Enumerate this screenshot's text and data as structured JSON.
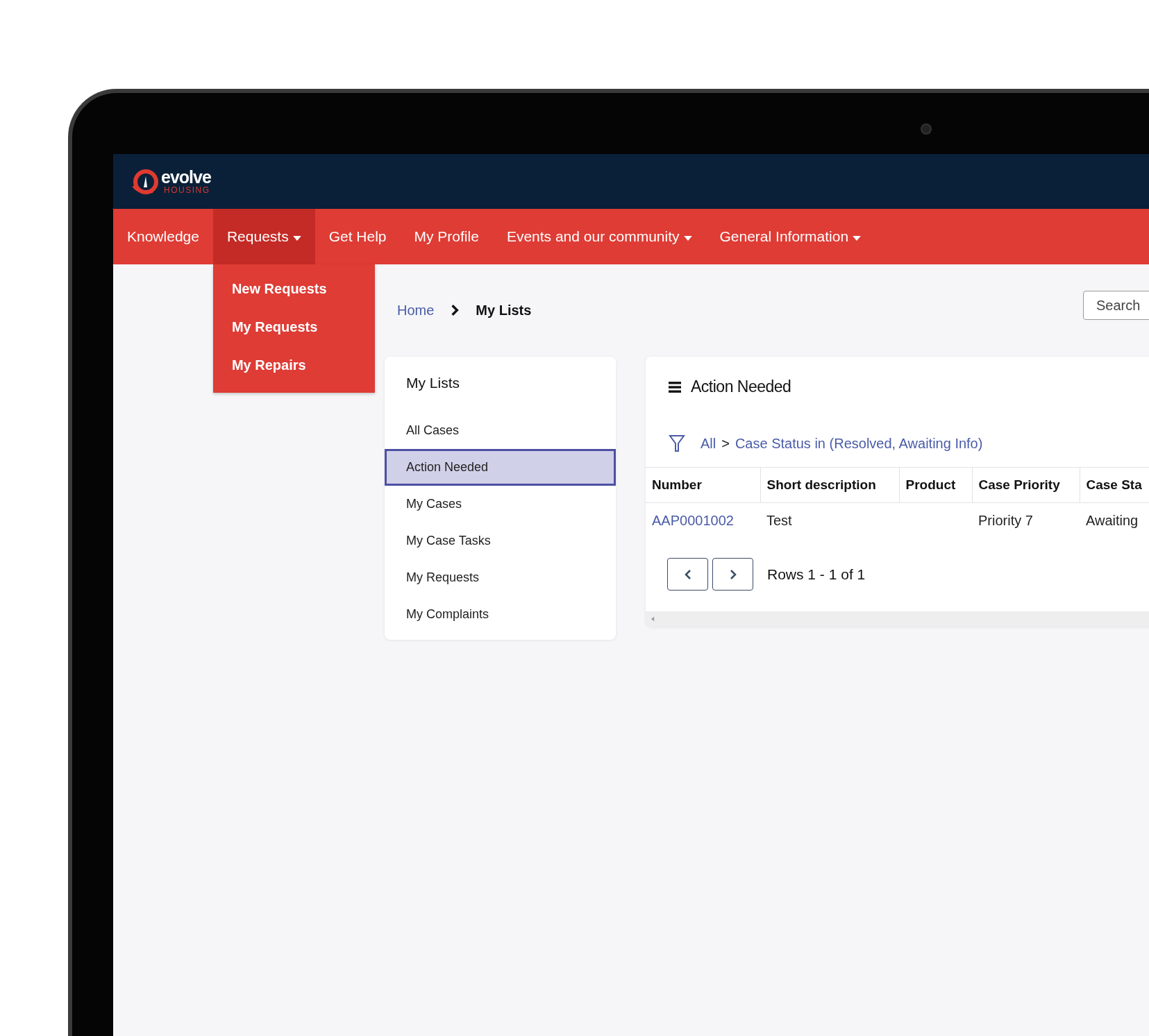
{
  "logo": {
    "name": "evolve",
    "subtitle": "HOUSING"
  },
  "nav": [
    {
      "label": "Knowledge",
      "selected": false,
      "has_menu": false
    },
    {
      "label": "Requests",
      "selected": true,
      "has_menu": true
    },
    {
      "label": "Get Help",
      "selected": false,
      "has_menu": false
    },
    {
      "label": "My Profile",
      "selected": false,
      "has_menu": false
    },
    {
      "label": "Events and our community",
      "selected": false,
      "has_menu": true
    },
    {
      "label": "General Information",
      "selected": false,
      "has_menu": true
    }
  ],
  "dropdown": {
    "items": [
      "New Requests",
      "My Requests",
      "My Repairs"
    ]
  },
  "breadcrumb": [
    {
      "label": "Home",
      "kind": "link"
    },
    {
      "label": "My Lists",
      "kind": "current"
    }
  ],
  "search": {
    "placeholder": "Search"
  },
  "lists_card": {
    "title": "My Lists",
    "items": [
      {
        "label": "All Cases",
        "selected": false
      },
      {
        "label": "Action Needed",
        "selected": true
      },
      {
        "label": "My Cases",
        "selected": false
      },
      {
        "label": "My Case Tasks",
        "selected": false
      },
      {
        "label": "My Requests",
        "selected": false
      },
      {
        "label": "My Complaints",
        "selected": false
      }
    ]
  },
  "results": {
    "title": "Action Needed",
    "filter": {
      "root": "All",
      "separator": ">",
      "condition": "Case Status in (Resolved, Awaiting Info)"
    },
    "table": {
      "columns": [
        "Number",
        "Short description",
        "Product",
        "Case Priority",
        "Case Sta"
      ],
      "rows": [
        {
          "cells": [
            "AAP0001002",
            "Test",
            null,
            "Priority 7",
            "Awaiting"
          ]
        }
      ]
    },
    "pagination": {
      "summary": "Rows 1 - 1 of 1"
    }
  }
}
